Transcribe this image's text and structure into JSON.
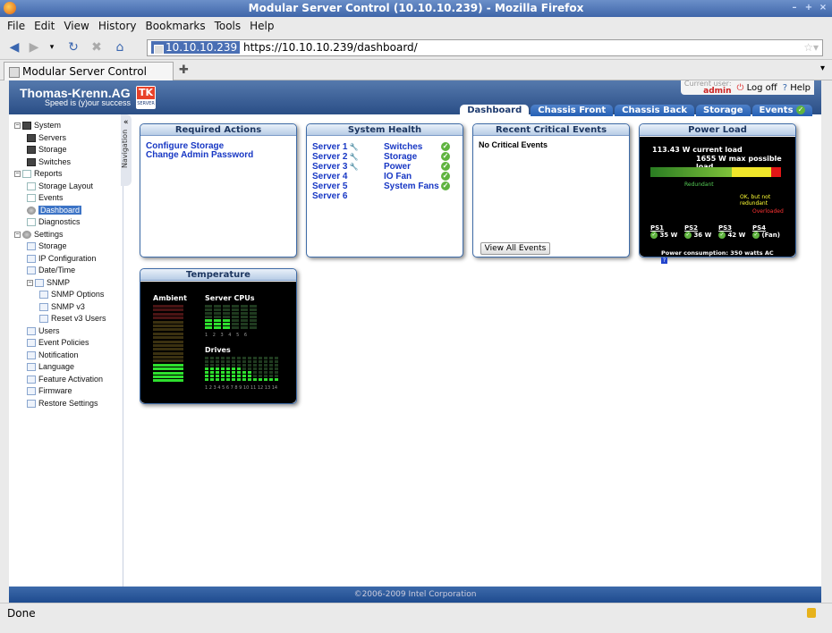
{
  "window": {
    "title": "Modular Server Control (10.10.10.239) - Mozilla Firefox"
  },
  "menu": [
    "File",
    "Edit",
    "View",
    "History",
    "Bookmarks",
    "Tools",
    "Help"
  ],
  "urlbar": {
    "host": "10.10.10.239",
    "url": "https://10.10.10.239/dashboard/"
  },
  "tab": {
    "label": "Modular Server Control (10.10...."
  },
  "header": {
    "logo": "Thomas-Krenn.AG",
    "slogan": "Speed is (y)our success",
    "tk": "TK",
    "tk_sub": "SERVER"
  },
  "user": {
    "label": "Current user:",
    "name": "admin",
    "logoff": "Log off",
    "help": "Help"
  },
  "main_tabs": [
    "Dashboard",
    "Chassis Front",
    "Chassis Back",
    "Storage",
    "Events"
  ],
  "navigation": {
    "label": "Navigation",
    "collapse": "«"
  },
  "sidebar": [
    {
      "label": "System",
      "indent": 0,
      "icon": "server-icon"
    },
    {
      "label": "Servers",
      "indent": 1,
      "icon": "server-icon"
    },
    {
      "label": "Storage",
      "indent": 1,
      "icon": "server-icon"
    },
    {
      "label": "Switches",
      "indent": 1,
      "icon": "server-icon"
    },
    {
      "label": "Reports",
      "indent": 0,
      "icon": "document-icon"
    },
    {
      "label": "Storage Layout",
      "indent": 1,
      "icon": "document-icon"
    },
    {
      "label": "Events",
      "indent": 1,
      "icon": "document-icon"
    },
    {
      "label": "Dashboard",
      "indent": 1,
      "icon": "dashboard-icon",
      "selected": true
    },
    {
      "label": "Diagnostics",
      "indent": 1,
      "icon": "document-icon"
    },
    {
      "label": "Settings",
      "indent": 0,
      "icon": "gear-icon"
    },
    {
      "label": "Storage",
      "indent": 1,
      "icon": "page-icon"
    },
    {
      "label": "IP Configuration",
      "indent": 1,
      "icon": "page-icon"
    },
    {
      "label": "Date/Time",
      "indent": 1,
      "icon": "page-icon"
    },
    {
      "label": "SNMP",
      "indent": 1,
      "icon": "page-icon"
    },
    {
      "label": "SNMP Options",
      "indent": 2,
      "icon": "page-icon"
    },
    {
      "label": "SNMP v3",
      "indent": 2,
      "icon": "page-icon"
    },
    {
      "label": "Reset v3 Users",
      "indent": 2,
      "icon": "page-icon"
    },
    {
      "label": "Users",
      "indent": 1,
      "icon": "page-icon"
    },
    {
      "label": "Event Policies",
      "indent": 1,
      "icon": "page-icon"
    },
    {
      "label": "Notification",
      "indent": 1,
      "icon": "page-icon"
    },
    {
      "label": "Language",
      "indent": 1,
      "icon": "page-icon"
    },
    {
      "label": "Feature Activation",
      "indent": 1,
      "icon": "page-icon"
    },
    {
      "label": "Firmware",
      "indent": 1,
      "icon": "page-icon"
    },
    {
      "label": "Restore Settings",
      "indent": 1,
      "icon": "page-icon"
    }
  ],
  "required_actions": {
    "title": "Required Actions",
    "items": [
      "Configure Storage",
      "Change Admin Password"
    ]
  },
  "system_health": {
    "title": "System Health",
    "servers": [
      "Server 1",
      "Server 2",
      "Server 3",
      "Server 4",
      "Server 5",
      "Server 6"
    ],
    "components": [
      "Switches",
      "Storage",
      "Power",
      "IO Fan",
      "System Fans"
    ]
  },
  "events": {
    "title": "Recent Critical Events",
    "message": "No Critical Events",
    "button": "View All Events"
  },
  "power": {
    "title": "Power Load",
    "current": "113.43 W current load",
    "max": "1655 W max possible load",
    "redundant": "Redundant",
    "ok_not_redundant": "OK, but not redundant",
    "overloaded": "Overloaded",
    "psu": [
      {
        "name": "PS1",
        "value": "35 W"
      },
      {
        "name": "PS2",
        "value": "36 W"
      },
      {
        "name": "PS3",
        "value": "42 W"
      },
      {
        "name": "PS4",
        "value": "(Fan)"
      }
    ],
    "consumption": "Power consumption: 350 watts AC",
    "help": "?"
  },
  "temperature": {
    "title": "Temperature",
    "ambient": "Ambient",
    "cpus": "Server CPUs",
    "cpu_nums": "1 2 3 4 5 6",
    "drives": "Drives",
    "drive_nums": "1 2 3 4 5 6 7 8 9 10 11 12 13 14"
  },
  "footer": "©2006-2009 Intel Corporation",
  "status": "Done"
}
